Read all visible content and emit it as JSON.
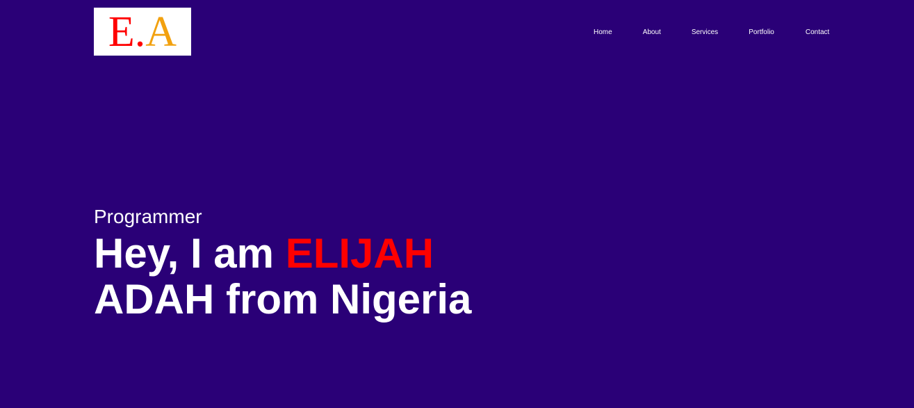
{
  "logo": {
    "part1": "E",
    "part2": ".",
    "part3": "A",
    "colors": {
      "letter_e": "#ff0000",
      "dot": "#ff0000",
      "letter_a": "#f2a10f",
      "background": "#ffffff"
    }
  },
  "nav": {
    "items": [
      {
        "label": "Home"
      },
      {
        "label": "About"
      },
      {
        "label": "Services"
      },
      {
        "label": "Portfolio"
      },
      {
        "label": "Contact"
      }
    ]
  },
  "hero": {
    "subtitle": "Programmer",
    "headline_prefix": "Hey, I am ",
    "headline_highlight": "ELIJAH",
    "headline_suffix": " ADAH from Nigeria"
  },
  "colors": {
    "page_background": "#2a0077",
    "text": "#ffffff",
    "accent": "#ff0000"
  }
}
